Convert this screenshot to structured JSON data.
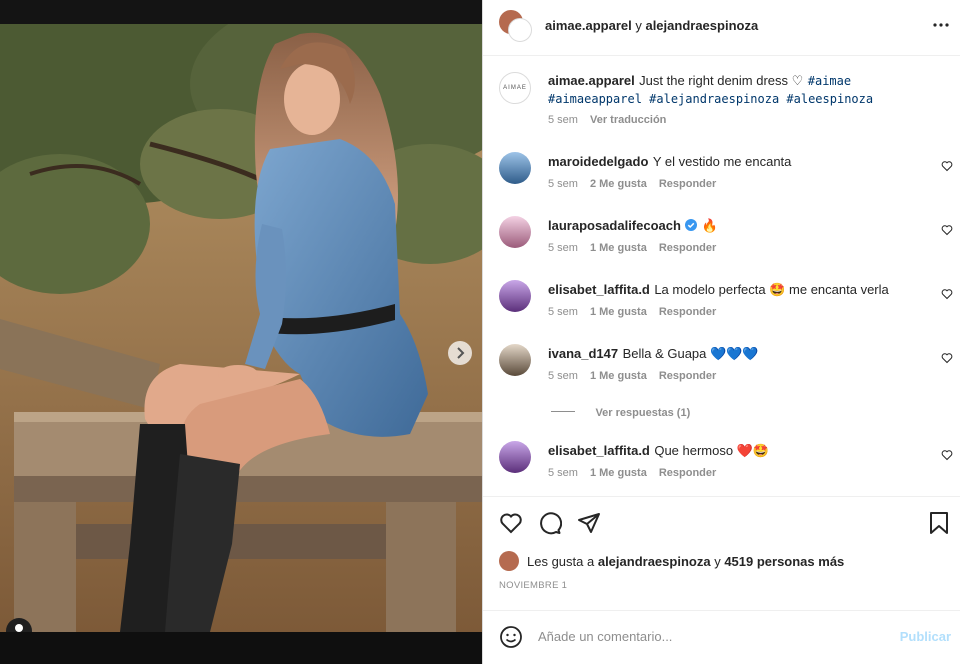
{
  "header": {
    "author": "aimae.apparel",
    "connector": "y",
    "coauthor": "alejandraespinoza",
    "more_icon": "more-options-icon"
  },
  "caption": {
    "avatar_text": "AIMAE",
    "username": "aimae.apparel",
    "text": "Just the right denim dress ♡",
    "hashtags_line1": "#aimae",
    "hashtags_line2": "#aimaeapparel #alejandraespinoza #aleespinoza",
    "time": "5 sem",
    "translate": "Ver traducción"
  },
  "comments": [
    {
      "username": "maroidedelgado",
      "text": "Y el vestido me encanta",
      "time": "5 sem",
      "likes": "2 Me gusta",
      "reply": "Responder"
    },
    {
      "username": "lauraposadalifecoach",
      "text": "🔥",
      "verified": true,
      "time": "5 sem",
      "likes": "1 Me gusta",
      "reply": "Responder"
    },
    {
      "username": "elisabet_laffita.d",
      "text": "La modelo perfecta 🤩 me encanta verla",
      "time": "5 sem",
      "likes": "1 Me gusta",
      "reply": "Responder"
    },
    {
      "username": "ivana_d147",
      "text": "Bella & Guapa 💙💙💙",
      "time": "5 sem",
      "likes": "1 Me gusta",
      "reply": "Responder"
    },
    {
      "username": "elisabet_laffita.d",
      "text": "Que hermoso ❤️🤩",
      "time": "5 sem",
      "likes": "1 Me gusta",
      "reply": "Responder"
    }
  ],
  "replies": {
    "label": "Ver respuestas (1)"
  },
  "likes": {
    "prefix": "Les gusta a",
    "user": "alejandraespinoza",
    "connector": "y",
    "others": "4519 personas más"
  },
  "date": "NOVIEMBRE 1",
  "add_comment": {
    "placeholder": "Añade un comentario...",
    "submit": "Publicar"
  },
  "carousel": {
    "slides": 4,
    "active": 0
  },
  "colors": {
    "accent": "#0095f6",
    "link": "#00376b",
    "muted": "#8e8e8e",
    "verified": "#3897f0"
  }
}
